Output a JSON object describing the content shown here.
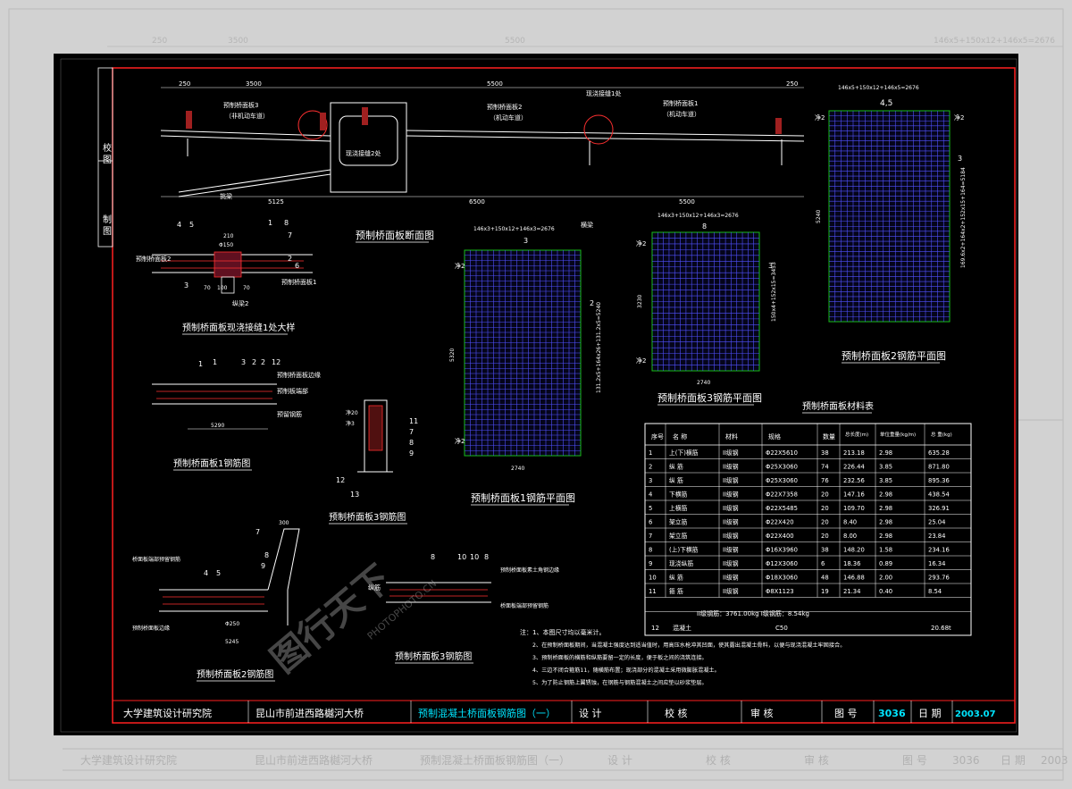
{
  "background": {
    "ghost_color": "#d2d2d2",
    "ghost_institute": "大学建筑设计研究院",
    "ghost_project": "昆山市前进西路樾河大桥",
    "ghost_drawing": "预制混凝土桥面板钢筋图（一）",
    "ghost_cells": [
      "设 计",
      "校 核",
      "审 核",
      "图 号",
      "3036",
      "日 期",
      "2003"
    ],
    "ghost_top_dims": [
      "250",
      "3500",
      "5500",
      "146x5+150x12+146x5=2676"
    ]
  },
  "colors": {
    "sheet": "#000000",
    "border": "#ff2020",
    "line": "#ffffff",
    "text": "#ffffff",
    "yellow": "#ffff00",
    "cyan": "#00e5ff",
    "green": "#18c018",
    "mesh": "#5050ff",
    "rebar": "#ff3030"
  },
  "side_strip": {
    "check": "校 图",
    "draw": "制 图"
  },
  "section": {
    "title": "预制桥面板断面图",
    "panel3_label": "预制桥面板3",
    "panel3_sub": "（非机动车道）",
    "panel2_label": "预制桥面板2",
    "panel2_sub": "（机动车道）",
    "panel1_label": "预制桥面板1",
    "panel1_sub": "（机动车道）",
    "joint_label": "现浇接缝2处",
    "joint1_label": "现浇接缝1处",
    "beam_left": "挑梁",
    "beam_right": "横梁",
    "dim_top": [
      "250",
      "3500",
      "5500",
      "250"
    ],
    "dim_bottom": [
      "5125",
      "6500",
      "5500"
    ]
  },
  "plans": {
    "p1": {
      "title": "预制桥面板1钢筋平面图",
      "dim_top": "146x3+150x12+146x3=2676",
      "dim_bottom": "2740",
      "dim_left": "5320",
      "side_dims": "131.2x5+164x26+131.2x5=5240",
      "tags": [
        "3",
        "2"
      ],
      "clear": [
        "净2",
        "净2"
      ]
    },
    "p2": {
      "title": "预制桥面板2钢筋平面图",
      "dim_top": "146x5+150x12+146x5=2676",
      "dim_bottom": "",
      "dim_left": "5240",
      "side_dims": "169.6x2+164x2+152x15+164=5184",
      "tags": [
        "4,5",
        "3"
      ],
      "clear": [
        "净2",
        "净2"
      ]
    },
    "p3": {
      "title": "预制桥面板3钢筋平面图",
      "dim_top": "146x3+150x12+146x3=2676",
      "dim_bottom": "2740",
      "dim_left": "3230",
      "side_dims": "150x4+152x15=3453",
      "tags": [
        "8",
        "3"
      ],
      "clear": [
        "净2",
        "净2"
      ]
    }
  },
  "details": {
    "joint_title": "预制桥面板现浇接缝1处大样",
    "joint_labels": [
      "预制桥面板2",
      "预制桥面板1",
      "纵梁2"
    ],
    "joint_tags": [
      "4",
      "5",
      "1",
      "8",
      "7",
      "3",
      "6",
      "2"
    ],
    "joint_dims": [
      "210",
      "Φ150",
      "70",
      "100",
      "70"
    ],
    "rebar1_title": "预制桥面板1钢筋图",
    "rebar1_labels": [
      "预制桥面板边缘",
      "预制板端部",
      "预留钢筋"
    ],
    "rebar1_tags": [
      "1",
      "1",
      "3",
      "2",
      "2",
      "12"
    ],
    "rebar1_dim": "5290",
    "rebar3s_title": "预制桥面板3钢筋图",
    "rebar3s_tags": [
      "11",
      "7",
      "8",
      "9",
      "12",
      "13"
    ],
    "rebar3s_labels": [
      "净3",
      "净20"
    ],
    "rebar2_title": "预制桥面板2钢筋图",
    "rebar2_labels": [
      "桥面板端部预留钢筋",
      "预制桥面板边缘"
    ],
    "rebar2_tags": [
      "7",
      "4",
      "5",
      "9",
      "8"
    ],
    "rebar2_dims": [
      "300",
      "Φ250",
      "5245"
    ],
    "rebar3_title": "预制桥面板3钢筋图",
    "rebar3_labels": [
      "预制桥面板素土角钢边缘",
      "桥面板端部预留钢筋",
      "纵筋"
    ],
    "rebar3_tags": [
      "8",
      "10",
      "10",
      "8"
    ]
  },
  "materials": {
    "title": "预制桥面板材料表",
    "headers": [
      "序号",
      "名 称",
      "材料",
      "规格",
      "数量",
      "总长度(m)",
      "单位重量(kg/m)",
      "总 重(kg)"
    ],
    "rows": [
      [
        "1",
        "上(下)横筋",
        "II级钢",
        "Φ22X5610",
        "38",
        "213.18",
        "2.98",
        "635.28"
      ],
      [
        "2",
        "纵 筋",
        "II级钢",
        "Φ25X3060",
        "74",
        "226.44",
        "3.85",
        "871.80"
      ],
      [
        "3",
        "纵 筋",
        "II级钢",
        "Φ25X3060",
        "76",
        "232.56",
        "3.85",
        "895.36"
      ],
      [
        "4",
        "下横筋",
        "II级钢",
        "Φ22X7358",
        "20",
        "147.16",
        "2.98",
        "438.54"
      ],
      [
        "5",
        "上横筋",
        "II级钢",
        "Φ22X5485",
        "20",
        "109.70",
        "2.98",
        "326.91"
      ],
      [
        "6",
        "架立筋",
        "II级钢",
        "Φ22X420",
        "20",
        "8.40",
        "2.98",
        "25.04"
      ],
      [
        "7",
        "架立筋",
        "II级钢",
        "Φ22X400",
        "20",
        "8.00",
        "2.98",
        "23.84"
      ],
      [
        "8",
        "(上)下横筋",
        "II级钢",
        "Φ16X3960",
        "38",
        "148.20",
        "1.58",
        "234.16"
      ],
      [
        "9",
        "现浇纵筋",
        "II级钢",
        "Φ12X3060",
        "6",
        "18.36",
        "0.89",
        "16.34"
      ],
      [
        "10",
        "纵 筋",
        "II级钢",
        "Φ18X3060",
        "48",
        "146.88",
        "2.00",
        "293.76"
      ],
      [
        "11",
        "箍 筋",
        "II级钢",
        "Φ8X1123",
        "19",
        "21.34",
        "0.40",
        "8.54"
      ]
    ],
    "summary": "II级钢筋：3761.00kg    I级钢筋：8.54kg",
    "concrete": [
      "12",
      "混凝土",
      "C50",
      "20.68t"
    ]
  },
  "notes": [
    "注：1、本图尺寸均以毫米计。",
    "2、在预制桥面板期间，当混凝土强度达到适当值时，用高压水枪冲其凹面，使其露出混凝土骨料，以便与现浇混凝土牢固接合。",
    "3、预制桥面板的横筋和纵筋要留一定的长度，便于板之间的浇筑连接。",
    "4、三边不闭合箍筋11，随横筋布置；现浇部分的混凝土采用微膨胀混凝土。",
    "5、为了防止钢筋上翼锈蚀，在钢筋与钢筋混凝土之间应垫以砂浆垫层。"
  ],
  "titleblock": {
    "institute": "大学建筑设计研究院",
    "project": "昆山市前进西路樾河大桥",
    "drawing": "预制混凝土桥面板钢筋图（一）",
    "design": "设 计",
    "check": "校 核",
    "review": "审 核",
    "number_label": "图 号",
    "number": "3036",
    "date_label": "日 期",
    "date": "2003.07"
  },
  "watermark": {
    "brand": "图行天下",
    "site": "PHOTOPHOTO.CN"
  }
}
